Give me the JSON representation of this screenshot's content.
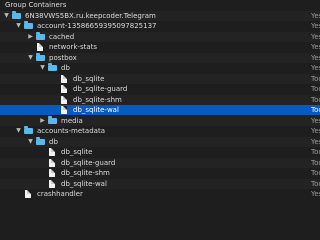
{
  "rows": [
    {
      "name": "Group Containers",
      "kind": "",
      "level": 0,
      "disclosure": "",
      "icon": "none"
    },
    {
      "name": "6N38VWS5BX.ru.keepcoder.Telegram",
      "kind": "Yes",
      "level": 0,
      "disclosure": "open",
      "icon": "folder"
    },
    {
      "name": "account-13586659395097825137",
      "kind": "Yes",
      "level": 1,
      "disclosure": "open",
      "icon": "folder"
    },
    {
      "name": "cached",
      "kind": "Yes",
      "level": 2,
      "disclosure": "closed",
      "icon": "folder"
    },
    {
      "name": "network-stats",
      "kind": "Yes",
      "level": 2,
      "disclosure": "",
      "icon": "doc"
    },
    {
      "name": "postbox",
      "kind": "Yes",
      "level": 2,
      "disclosure": "open",
      "icon": "folder"
    },
    {
      "name": "db",
      "kind": "Yes",
      "level": 3,
      "disclosure": "open",
      "icon": "folder"
    },
    {
      "name": "db_sqlite",
      "kind": "Too",
      "level": 4,
      "disclosure": "",
      "icon": "doc"
    },
    {
      "name": "db_sqlite-guard",
      "kind": "Too",
      "level": 4,
      "disclosure": "",
      "icon": "doc"
    },
    {
      "name": "db_sqlite-shm",
      "kind": "Too",
      "level": 4,
      "disclosure": "",
      "icon": "doc"
    },
    {
      "name": "db_sqlite-wal",
      "kind": "Too",
      "level": 4,
      "disclosure": "",
      "icon": "doc",
      "selected": true
    },
    {
      "name": "media",
      "kind": "Yes",
      "level": 3,
      "disclosure": "closed",
      "icon": "folder"
    },
    {
      "name": "accounts-metadata",
      "kind": "Yes",
      "level": 1,
      "disclosure": "open",
      "icon": "folder"
    },
    {
      "name": "db",
      "kind": "Yes",
      "level": 2,
      "disclosure": "open",
      "icon": "folder"
    },
    {
      "name": "db_sqlite",
      "kind": "Too",
      "level": 3,
      "disclosure": "",
      "icon": "doc"
    },
    {
      "name": "db_sqlite-guard",
      "kind": "Too",
      "level": 3,
      "disclosure": "",
      "icon": "doc"
    },
    {
      "name": "db_sqlite-shm",
      "kind": "Too",
      "level": 3,
      "disclosure": "",
      "icon": "doc"
    },
    {
      "name": "db_sqlite-wal",
      "kind": "Too",
      "level": 3,
      "disclosure": "",
      "icon": "doc"
    },
    {
      "name": "crashhandler",
      "kind": "Yes",
      "level": 1,
      "disclosure": "",
      "icon": "doc"
    }
  ],
  "glyphs": {
    "open": "▼",
    "closed": "▶"
  },
  "colors": {
    "folder": "#5cb8e8",
    "selection": "#0a58c4",
    "background": "#1e1e1e"
  }
}
